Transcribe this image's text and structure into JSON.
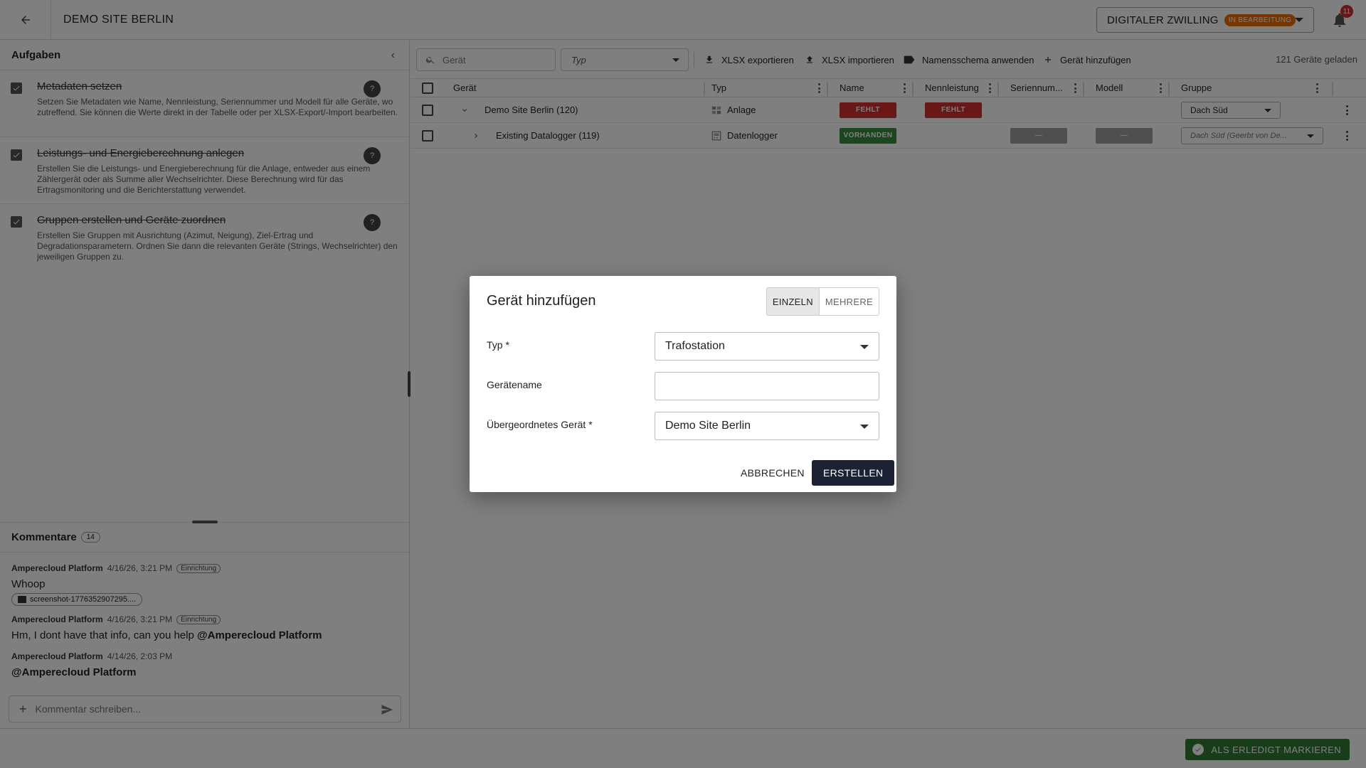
{
  "header": {
    "site_title": "DEMO SITE BERLIN",
    "twin_label": "DIGITALER ZWILLING",
    "twin_status": "IN BEARBEITUNG",
    "notification_count": "11"
  },
  "tasks": {
    "title": "Aufgaben",
    "items": [
      {
        "title": "Metadaten setzen",
        "desc": "Setzen Sie Metadaten wie Name, Nennleistung, Seriennummer und Modell für alle Geräte, wo zutreffend. Sie können die Werte direkt in der Tabelle oder per XLSX-Export/-Import bearbeiten.",
        "help": "?"
      },
      {
        "title": "Leistungs- und Energieberechnung anlegen",
        "desc": "Erstellen Sie die Leistungs- und Energieberechnung für die Anlage, entweder aus einem Zählergerät oder als Summe aller Wechselrichter. Diese Berechnung wird für das Ertragsmonitoring und die Berichterstattung verwendet.",
        "help": "?"
      },
      {
        "title": "Gruppen erstellen und Geräte zuordnen",
        "desc": "Erstellen Sie Gruppen mit Ausrichtung (Azimut, Neigung), Ziel-Ertrag und Degradationsparametern. Ordnen Sie dann die relevanten Geräte (Strings, Wechselrichter) den jeweiligen Gruppen zu.",
        "help": "?"
      }
    ]
  },
  "comments": {
    "title": "Kommentare",
    "count": "14",
    "items": [
      {
        "author": "Amperecloud Platform",
        "time": "4/16/26, 3:21 PM",
        "tag": "Einrichtung",
        "text": "Whoop",
        "attachment": "screenshot-1776352907295...."
      },
      {
        "author": "Amperecloud Platform",
        "time": "4/16/26, 3:21 PM",
        "tag": "Einrichtung",
        "text": "Hm, I dont have that info, can you help ",
        "mention": "@Amperecloud Platform"
      },
      {
        "author": "Amperecloud Platform",
        "time": "4/14/26, 2:03 PM",
        "mention": "@Amperecloud Platform"
      }
    ],
    "input_placeholder": "Kommentar schreiben..."
  },
  "toolbar": {
    "search_placeholder": "Gerät",
    "type_filter": "Typ",
    "export_label": "XLSX exportieren",
    "import_label": "XLSX importieren",
    "naming_label": "Namensschema anwenden",
    "add_label": "Gerät hinzufügen",
    "loaded": "121 Geräte geladen"
  },
  "table": {
    "columns": [
      "Gerät",
      "Typ",
      "Name",
      "Nennleistung",
      "Seriennum...",
      "Modell",
      "Gruppe"
    ],
    "rows": [
      {
        "device": "Demo Site Berlin (120)",
        "type": "Anlage",
        "name_status": "FEHLT",
        "power_status": "FEHLT",
        "serial": "",
        "model": "",
        "group": "Dach Süd"
      },
      {
        "device": "Existing Datalogger (119)",
        "type": "Datenlogger",
        "name_status": "VORHANDEN",
        "power_status": "",
        "serial": "—",
        "model": "—",
        "group": "Dach Süd (Geerbt von De..."
      }
    ]
  },
  "footer": {
    "done_label": "ALS ERLEDIGT MARKIEREN"
  },
  "dialog": {
    "title": "Gerät hinzufügen",
    "mode_single": "EINZELN",
    "mode_multiple": "MEHRERE",
    "type_label": "Typ *",
    "type_value": "Trafostation",
    "name_label": "Gerätename",
    "name_value": "",
    "parent_label": "Übergeordnetes Gerät *",
    "parent_value": "Demo Site Berlin",
    "cancel_label": "ABBRECHEN",
    "create_label": "ERSTELLEN"
  },
  "colors": {
    "accent_dark": "#1c2233",
    "status_missing": "#d32f2f",
    "status_present": "#388e3c",
    "badge_orange": "#ef6c00",
    "done_green": "#2e7d32"
  }
}
